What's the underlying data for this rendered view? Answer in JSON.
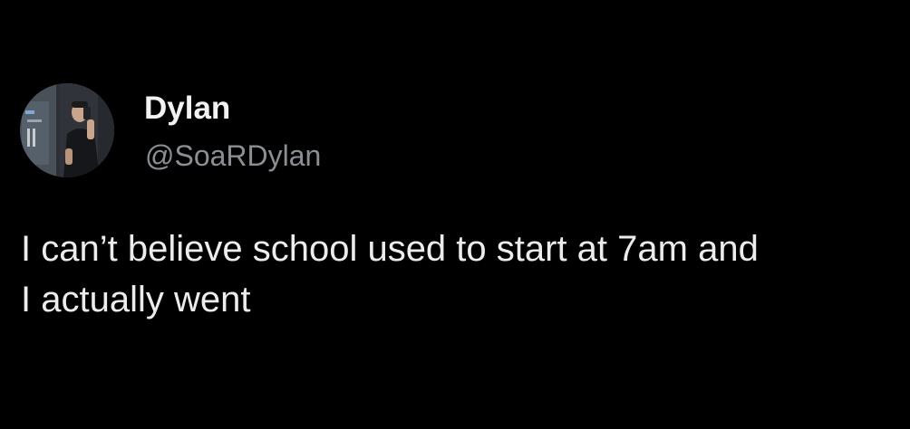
{
  "tweet": {
    "author": {
      "display_name": "Dylan",
      "handle": "@SoaRDylan",
      "avatar_icon": "profile-photo"
    },
    "text_lines": [
      "I can’t believe school used to start at 7am and",
      "I actually went"
    ]
  },
  "colors": {
    "background": "#000000",
    "primary_text": "#e7e9ea",
    "secondary_text": "#8b8f94"
  }
}
